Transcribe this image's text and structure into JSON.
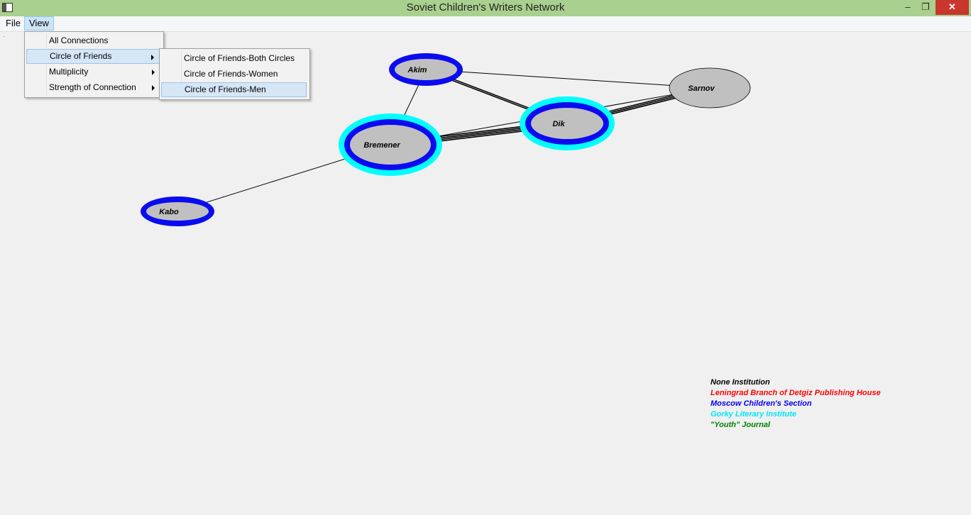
{
  "window": {
    "title": "Soviet Children's Writers Network",
    "minimize_glyph": "–",
    "restore_glyph": "❐",
    "close_glyph": "✕"
  },
  "menubar": {
    "file": "File",
    "view": "View"
  },
  "view_menu": [
    {
      "label": "All Connections",
      "submenu": false
    },
    {
      "label": "Circle of Friends",
      "submenu": true
    },
    {
      "label": "Multiplicity",
      "submenu": true
    },
    {
      "label": "Strength of Connection",
      "submenu": true
    }
  ],
  "circle_submenu": [
    {
      "label": "Circle of Friends-Both Circles"
    },
    {
      "label": "Circle of Friends-Women"
    },
    {
      "label": "Circle of Friends-Men"
    }
  ],
  "network": {
    "nodes": [
      {
        "id": "akim",
        "label": "Akim",
        "ring_colors": [
          "#0b0bf0"
        ]
      },
      {
        "id": "sarnov",
        "label": "Sarnov",
        "ring_colors": []
      },
      {
        "id": "dik",
        "label": "Dik",
        "ring_colors": [
          "#00ffff",
          "#0b0bf0"
        ]
      },
      {
        "id": "bremener",
        "label": "Bremener",
        "ring_colors": [
          "#00ffff",
          "#0b0bf0"
        ]
      },
      {
        "id": "kabo",
        "label": "Kabo",
        "ring_colors": [
          "#0b0bf0"
        ]
      }
    ],
    "edges": [
      {
        "from": "akim",
        "to": "sarnov",
        "strength": 1
      },
      {
        "from": "akim",
        "to": "dik",
        "strength": 2
      },
      {
        "from": "akim",
        "to": "bremener",
        "strength": 1
      },
      {
        "from": "dik",
        "to": "sarnov",
        "strength": 3
      },
      {
        "from": "bremener",
        "to": "dik",
        "strength": 4
      },
      {
        "from": "bremener",
        "to": "sarnov",
        "strength": 1
      },
      {
        "from": "bremener",
        "to": "kabo",
        "strength": 1
      }
    ]
  },
  "legend": [
    {
      "label": "None Institution",
      "color": "#000000"
    },
    {
      "label": "Leningrad Branch of Detgiz Publishing House",
      "color": "#ff0000"
    },
    {
      "label": "Moscow Children's Section",
      "color": "#0000ff"
    },
    {
      "label": "Gorky Literary Institute",
      "color": "#00e5ff"
    },
    {
      "label": "\"Youth\" Journal",
      "color": "#008000"
    }
  ]
}
